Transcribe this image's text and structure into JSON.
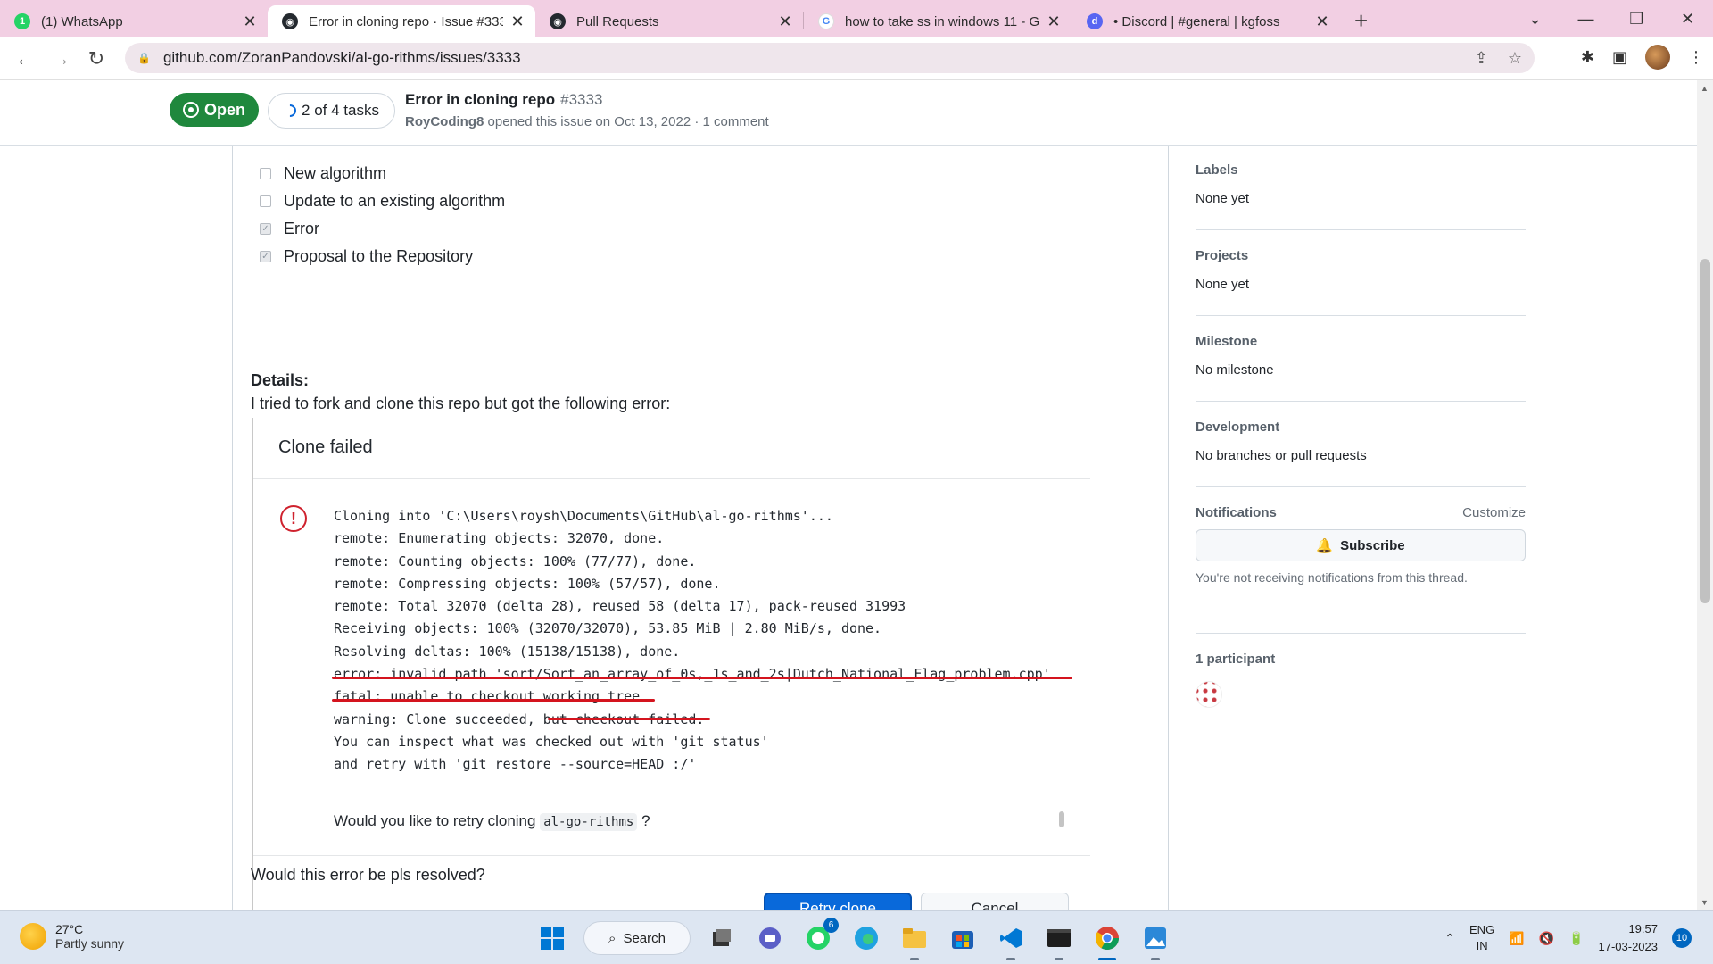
{
  "tabs": [
    {
      "title": "(1) WhatsApp",
      "icon": "whatsapp-icon",
      "color": "#25d366"
    },
    {
      "title": "Error in cloning repo · Issue #3333",
      "icon": "github-icon",
      "color": "#24292f"
    },
    {
      "title": "Pull Requests",
      "icon": "github-icon",
      "color": "#24292f"
    },
    {
      "title": "how to take ss in windows 11 - G",
      "icon": "google-icon",
      "color": "#4285f4"
    },
    {
      "title": "• Discord | #general | kgfoss",
      "icon": "discord-icon",
      "color": "#5865f2"
    }
  ],
  "address": {
    "url": "github.com/ZoranPandovski/al-go-rithms/issues/3333"
  },
  "issue": {
    "state": "Open",
    "tasks": "2 of 4 tasks",
    "title": "Error in cloning repo",
    "number": "#3333",
    "author": "RoyCoding8",
    "meta": " opened this issue on Oct 13, 2022 · 1 comment"
  },
  "checklist": [
    {
      "label": "New algorithm",
      "checked": false
    },
    {
      "label": "Update to an existing algorithm",
      "checked": false
    },
    {
      "label": "Error",
      "checked": true
    },
    {
      "label": "Proposal to the Repository",
      "checked": true
    }
  ],
  "details": {
    "heading": "Details:",
    "text": "I tried to fork and clone this repo but got the following error:",
    "footer": "Would this error be pls resolved?"
  },
  "dialog": {
    "title": "Clone failed",
    "log": [
      "Cloning into 'C:\\Users\\roysh\\Documents\\GitHub\\al-go-rithms'...",
      "remote: Enumerating objects: 32070, done.",
      "remote: Counting objects: 100% (77/77), done.",
      "remote: Compressing objects: 100% (57/57), done.",
      "remote: Total 32070 (delta 28), reused 58 (delta 17), pack-reused 31993",
      "Receiving objects: 100% (32070/32070), 53.85 MiB | 2.80 MiB/s, done.",
      "Resolving deltas: 100% (15138/15138), done.",
      "error: invalid path 'sort/Sort_an_array_of_0s,_1s_and_2s|Dutch_National_Flag_problem.cpp'",
      "fatal: unable to checkout working tree",
      "warning: Clone succeeded, but checkout failed.",
      "You can inspect what was checked out with 'git status'",
      "and retry with 'git restore --source=HEAD :/'"
    ],
    "retry_prefix": "Would you like to retry cloning ",
    "retry_repo": "al-go-rithms",
    "retry_suffix": " ?",
    "retry_button": "Retry clone",
    "cancel_button": "Cancel"
  },
  "sidebar": {
    "labels": {
      "heading": "Labels",
      "value": "None yet"
    },
    "projects": {
      "heading": "Projects",
      "value": "None yet"
    },
    "milestone": {
      "heading": "Milestone",
      "value": "No milestone"
    },
    "development": {
      "heading": "Development",
      "value": "No branches or pull requests"
    },
    "notifications": {
      "heading": "Notifications",
      "customize": "Customize",
      "subscribe": "Subscribe",
      "note": "You're not receiving notifications from this thread."
    },
    "participants": {
      "heading": "1 participant"
    }
  },
  "taskbar": {
    "weather_temp": "27°C",
    "weather_desc": "Partly sunny",
    "search": "Search",
    "whatsapp_badge": "6",
    "lang_top": "ENG",
    "lang_bottom": "IN",
    "time": "19:57",
    "date": "17-03-2023",
    "notifications": "10"
  },
  "colors": {
    "accent": "#0969da",
    "open_green": "#1f883d",
    "error_red": "#cf222e",
    "tab_bar": "#f2cfe3"
  }
}
